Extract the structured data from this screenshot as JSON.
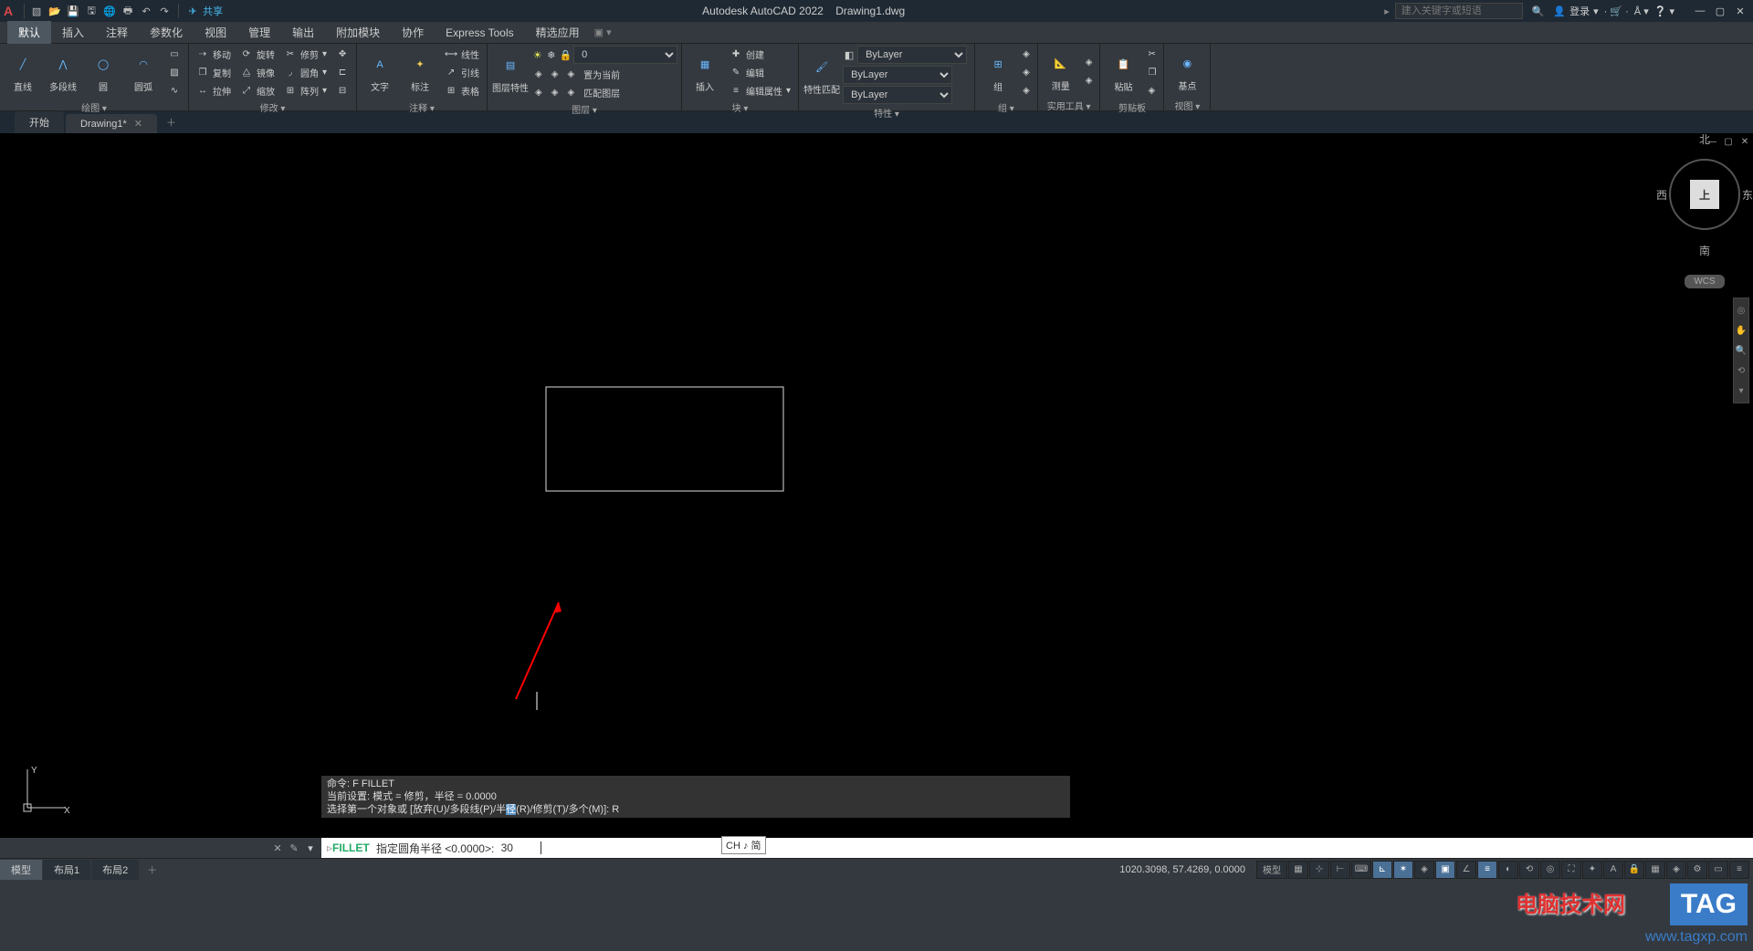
{
  "app": {
    "title": "Autodesk AutoCAD 2022",
    "file": "Drawing1.dwg",
    "share": "共享"
  },
  "search": {
    "placeholder": "建入关键字或短语"
  },
  "login": "登录",
  "menus": [
    "默认",
    "插入",
    "注释",
    "参数化",
    "视图",
    "管理",
    "输出",
    "附加模块",
    "协作",
    "Express Tools",
    "精选应用"
  ],
  "ribbon": {
    "draw": {
      "title": "绘图 ▾",
      "line": "直线",
      "pline": "多段线",
      "circle": "圆",
      "arc": "圆弧"
    },
    "modify": {
      "title": "修改 ▾",
      "move": "移动",
      "rotate": "旋转",
      "trim": "修剪",
      "copy": "复制",
      "mirror": "镜像",
      "fillet": "圆角",
      "stretch": "拉伸",
      "scale": "缩放",
      "array": "阵列"
    },
    "annot": {
      "title": "注释 ▾",
      "text": "文字",
      "dim": "标注",
      "leader": "引线",
      "table": "表格",
      "linear": "线性"
    },
    "layer": {
      "title": "图层 ▾",
      "props": "图层特性",
      "setcurrent": "置为当前",
      "match": "匹配图层",
      "current": "0"
    },
    "block": {
      "title": "块 ▾",
      "insert": "插入",
      "create": "创建",
      "edit": "编辑",
      "attr": "编辑属性"
    },
    "props": {
      "title": "特性 ▾",
      "match": "特性匹配",
      "bylayer": "ByLayer"
    },
    "group": {
      "title": "组 ▾",
      "group": "组"
    },
    "util": {
      "title": "实用工具 ▾",
      "measure": "测量"
    },
    "clip": {
      "title": "剪贴板",
      "paste": "粘贴"
    },
    "view": {
      "title": "视图 ▾",
      "base": "基点"
    }
  },
  "filetabs": {
    "start": "开始",
    "drawing": "Drawing1*"
  },
  "viewcube": {
    "face": "上",
    "n": "北",
    "s": "南",
    "e": "东",
    "w": "西",
    "wcs": "WCS"
  },
  "ucs": {
    "x": "X",
    "y": "Y"
  },
  "cmdhistory": {
    "l1": "命令: F FILLET",
    "l2": "当前设置: 模式 = 修剪，半径 = 0.0000",
    "l3a": "选择第一个对象或 [放弃(U)/多段线(P)/半",
    "l3b": "(R)/修剪(T)/多个(M)]: R"
  },
  "cmdline": {
    "name": "FILLET",
    "prompt": "指定圆角半径 <0.0000>:",
    "input": "30"
  },
  "ime": "CH ♪ 简",
  "modeltabs": [
    "模型",
    "布局1",
    "布局2"
  ],
  "status": {
    "coords": "1020.3098, 57.4269, 0.0000",
    "model": "模型"
  },
  "watermark": {
    "text": "电脑技术网",
    "tag": "TAG",
    "url": "www.tagxp.com"
  }
}
